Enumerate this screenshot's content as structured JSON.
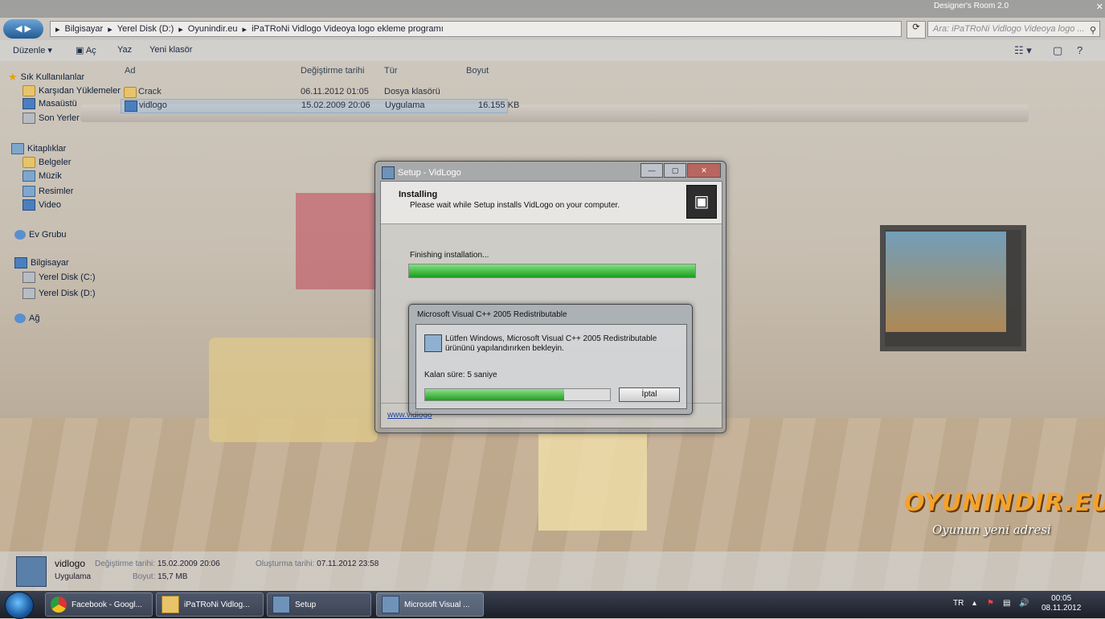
{
  "explorer": {
    "titlebar_app": "Designer's Room 2.0",
    "nav_back_icon": "back-arrow-icon",
    "breadcrumb": [
      "Bilgisayar",
      "Yerel Disk (D:)",
      "Oyunindir.eu",
      "iPaTRoNi Vidlogo Videoya logo ekleme programı"
    ],
    "search_placeholder": "Ara: iPaTRoNi Vidlogo Videoya logo ...",
    "commands": {
      "organize": "Düzenle",
      "open": "Aç",
      "print": "Yaz",
      "new_folder": "Yeni klasör"
    },
    "columns": {
      "name": "Ad",
      "date": "Değiştirme tarihi",
      "type": "Tür",
      "size": "Boyut"
    },
    "files": [
      {
        "name": "Crack",
        "date": "06.11.2012 01:05",
        "type": "Dosya klasörü",
        "size": ""
      },
      {
        "name": "vidlogo",
        "date": "15.02.2009 20:06",
        "type": "Uygulama",
        "size": "16.155 KB"
      }
    ],
    "nav": {
      "favorites": "Sık Kullanılanlar",
      "downloads": "Karşıdan Yüklemeler",
      "desktop": "Masaüstü",
      "recent": "Son Yerler",
      "libraries": "Kitaplıklar",
      "documents": "Belgeler",
      "music": "Müzik",
      "pictures": "Resimler",
      "video": "Video",
      "homegroup": "Ev Grubu",
      "computer": "Bilgisayar",
      "disk_c": "Yerel Disk (C:)",
      "disk_d": "Yerel Disk (D:)",
      "network": "Ağ"
    }
  },
  "setup_dialog": {
    "title": "Setup - VidLogo",
    "heading": "Installing",
    "subheading": "Please wait while Setup installs VidLogo on your computer.",
    "status": "Finishing installation...",
    "progress": 1.0,
    "footer_link": "www.vidlogo"
  },
  "vc_dialog": {
    "title": "Microsoft Visual C++ 2005 Redistributable",
    "message": "Lütfen Windows, Microsoft Visual C++ 2005 Redistributable ürününü yapılandırırken bekleyin.",
    "time_left": "Kalan süre: 5 saniye",
    "progress": 0.75,
    "cancel_label": "İptal"
  },
  "details": {
    "name": "vidlogo",
    "type": "Uygulama",
    "modified_label": "Değiştirme tarihi:",
    "modified": "15.02.2009 20:06",
    "size_label": "Boyut:",
    "size": "15,7 MB",
    "created_label": "Oluşturma tarihi:",
    "created": "07.11.2012 23:58"
  },
  "taskbar": {
    "items": [
      {
        "label": "Facebook - Googl...",
        "icon": "chrome-icon"
      },
      {
        "label": "iPaTRoNi Vidlog...",
        "icon": "folder-icon"
      },
      {
        "label": "Setup",
        "icon": "setup-icon"
      },
      {
        "label": "Microsoft Visual ...",
        "icon": "setup-icon"
      }
    ],
    "lang": "TR",
    "time": "00:05",
    "date": "08.11.2012"
  },
  "wallpaper": {
    "logo_text": "OYUNINDIR.EU",
    "logo_tagline": "Oyunun yeni adresi"
  },
  "colors": {
    "progress_green": "#1c9d1c",
    "taskbar": "#1b1f28",
    "link": "#1a3fa0"
  }
}
